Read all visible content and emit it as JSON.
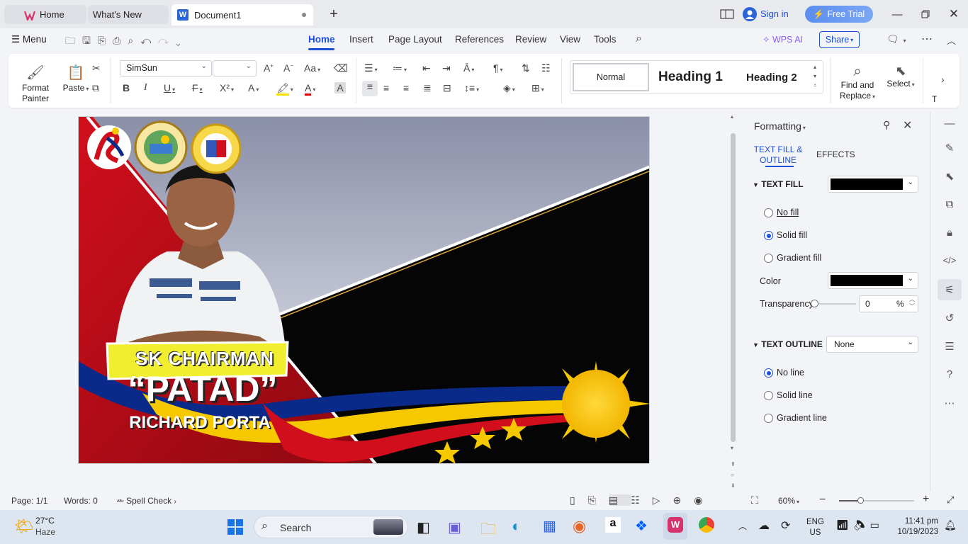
{
  "tabs": [
    {
      "label": "Home"
    },
    {
      "label": "What's New"
    },
    {
      "label": "Document1"
    }
  ],
  "titlebar": {
    "sign_in": "Sign in",
    "free_trial": "Free Trial"
  },
  "menubar": {
    "menu_label": "Menu",
    "tabs": [
      "Home",
      "Insert",
      "Page Layout",
      "References",
      "Review",
      "View",
      "Tools"
    ],
    "wps_ai": "WPS AI",
    "share": "Share"
  },
  "ribbon": {
    "format_painter": "Format Painter",
    "paste": "Paste",
    "font_name": "SimSun",
    "font_size": "",
    "styles": [
      "Normal",
      "Heading 1",
      "Heading 2"
    ],
    "find_replace": "Find and Replace",
    "select": "Select",
    "cut_label": "T"
  },
  "document": {
    "title_line": "SK CHAIRMAN",
    "nickname": "“PATAD”",
    "full_name": "RICHARD PORTA"
  },
  "panel": {
    "title": "Formatting",
    "tab_fill": "TEXT FILL & OUTLINE",
    "tab_effects": "EFFECTS",
    "text_fill": "TEXT FILL",
    "no_fill": "No fill",
    "solid_fill": "Solid fill",
    "gradient_fill": "Gradient fill",
    "color": "Color",
    "transparency": "Transparency",
    "transparency_value": "0",
    "percent": "%",
    "text_outline": "TEXT OUTLINE",
    "outline_value": "None",
    "no_line": "No line",
    "solid_line": "Solid line",
    "gradient_line": "Gradient line",
    "fill_color": "#000000"
  },
  "statusbar": {
    "page": "Page: 1/1",
    "words": "Words: 0",
    "spell_check": "Spell Check",
    "zoom": "60%"
  },
  "taskbar": {
    "weather_temp": "27°C",
    "weather_desc": "Haze",
    "search": "Search",
    "lang1": "ENG",
    "lang2": "US",
    "time": "11:41 pm",
    "date": "10/19/2023"
  },
  "colors": {
    "accent": "#1d4ed8",
    "free_trial_bg": "#5b8def",
    "flag_red": "#c8102e",
    "flag_blue": "#0a2a8a",
    "flag_yellow": "#f6c800"
  }
}
